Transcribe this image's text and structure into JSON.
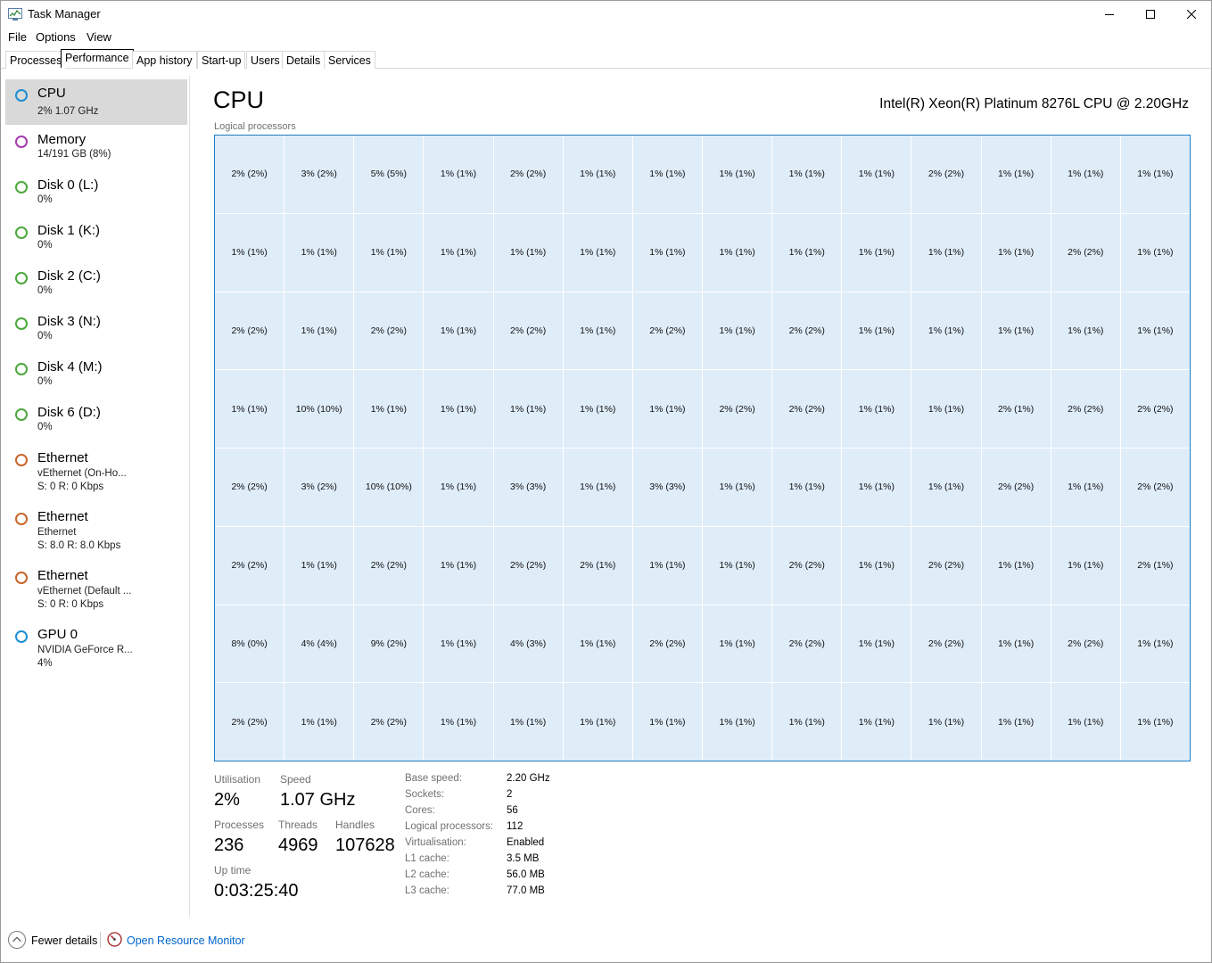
{
  "window": {
    "title": "Task Manager"
  },
  "menu": {
    "file": "File",
    "options": "Options",
    "view": "View"
  },
  "tabs": [
    "Processes",
    "Performance",
    "App history",
    "Start-up",
    "Users",
    "Details",
    "Services"
  ],
  "active_tab": "Performance",
  "sidebar": {
    "items": [
      {
        "title": "CPU",
        "lines": [
          "2%  1.07 GHz"
        ],
        "color": "#1c8fd2",
        "selected": true
      },
      {
        "title": "Memory",
        "lines": [
          "14/191 GB (8%)"
        ],
        "color": "#a63aad"
      },
      {
        "title": "Disk 0 (L:)",
        "lines": [
          "0%"
        ],
        "color": "#4ba83b"
      },
      {
        "title": "Disk 1 (K:)",
        "lines": [
          "0%"
        ],
        "color": "#4ba83b"
      },
      {
        "title": "Disk 2 (C:)",
        "lines": [
          "0%"
        ],
        "color": "#4ba83b"
      },
      {
        "title": "Disk 3 (N:)",
        "lines": [
          "0%"
        ],
        "color": "#4ba83b"
      },
      {
        "title": "Disk 4 (M:)",
        "lines": [
          "0%"
        ],
        "color": "#4ba83b"
      },
      {
        "title": "Disk 6 (D:)",
        "lines": [
          "0%"
        ],
        "color": "#4ba83b"
      },
      {
        "title": "Ethernet",
        "lines": [
          "vEthernet (On-Ho...",
          "S: 0  R: 0 Kbps"
        ],
        "color": "#c9652a"
      },
      {
        "title": "Ethernet",
        "lines": [
          "Ethernet",
          "S: 8.0  R: 8.0 Kbps"
        ],
        "color": "#c9652a"
      },
      {
        "title": "Ethernet",
        "lines": [
          "vEthernet (Default ...",
          "S: 0  R: 0 Kbps"
        ],
        "color": "#c9652a"
      },
      {
        "title": "GPU 0",
        "lines": [
          "NVIDIA GeForce R...",
          "4%"
        ],
        "color": "#1c8fd2"
      }
    ]
  },
  "main": {
    "title": "CPU",
    "cpu_name": "Intel(R) Xeon(R) Platinum 8276L CPU @ 2.20GHz",
    "grid_label": "Logical processors",
    "logical_processors": [
      [
        "2% (2%)",
        "3% (2%)",
        "5% (5%)",
        "1% (1%)",
        "2% (2%)",
        "1% (1%)",
        "1% (1%)",
        "1% (1%)",
        "1% (1%)",
        "1% (1%)",
        "2% (2%)",
        "1% (1%)",
        "1% (1%)",
        "1% (1%)"
      ],
      [
        "1% (1%)",
        "1% (1%)",
        "1% (1%)",
        "1% (1%)",
        "1% (1%)",
        "1% (1%)",
        "1% (1%)",
        "1% (1%)",
        "1% (1%)",
        "1% (1%)",
        "1% (1%)",
        "1% (1%)",
        "2% (2%)",
        "1% (1%)"
      ],
      [
        "2% (2%)",
        "1% (1%)",
        "2% (2%)",
        "1% (1%)",
        "2% (2%)",
        "1% (1%)",
        "2% (2%)",
        "1% (1%)",
        "2% (2%)",
        "1% (1%)",
        "1% (1%)",
        "1% (1%)",
        "1% (1%)",
        "1% (1%)"
      ],
      [
        "1% (1%)",
        "10% (10%)",
        "1% (1%)",
        "1% (1%)",
        "1% (1%)",
        "1% (1%)",
        "1% (1%)",
        "2% (2%)",
        "2% (2%)",
        "1% (1%)",
        "1% (1%)",
        "2% (1%)",
        "2% (2%)",
        "2% (2%)"
      ],
      [
        "2% (2%)",
        "3% (2%)",
        "10% (10%)",
        "1% (1%)",
        "3% (3%)",
        "1% (1%)",
        "3% (3%)",
        "1% (1%)",
        "1% (1%)",
        "1% (1%)",
        "1% (1%)",
        "2% (2%)",
        "1% (1%)",
        "2% (2%)"
      ],
      [
        "2% (2%)",
        "1% (1%)",
        "2% (2%)",
        "1% (1%)",
        "2% (2%)",
        "2% (1%)",
        "1% (1%)",
        "1% (1%)",
        "2% (2%)",
        "1% (1%)",
        "2% (2%)",
        "1% (1%)",
        "1% (1%)",
        "2% (1%)"
      ],
      [
        "8% (0%)",
        "4% (4%)",
        "9% (2%)",
        "1% (1%)",
        "4% (3%)",
        "1% (1%)",
        "2% (2%)",
        "1% (1%)",
        "2% (2%)",
        "1% (1%)",
        "2% (2%)",
        "1% (1%)",
        "2% (2%)",
        "1% (1%)"
      ],
      [
        "2% (2%)",
        "1% (1%)",
        "2% (2%)",
        "1% (1%)",
        "1% (1%)",
        "1% (1%)",
        "1% (1%)",
        "1% (1%)",
        "1% (1%)",
        "1% (1%)",
        "1% (1%)",
        "1% (1%)",
        "1% (1%)",
        "1% (1%)"
      ]
    ],
    "stats": {
      "utilisation_label": "Utilisation",
      "utilisation": "2%",
      "speed_label": "Speed",
      "speed": "1.07 GHz",
      "processes_label": "Processes",
      "processes": "236",
      "threads_label": "Threads",
      "threads": "4969",
      "handles_label": "Handles",
      "handles": "107628",
      "uptime_label": "Up time",
      "uptime": "0:03:25:40"
    },
    "specs": [
      {
        "label": "Base speed:",
        "value": "2.20 GHz"
      },
      {
        "label": "Sockets:",
        "value": "2"
      },
      {
        "label": "Cores:",
        "value": "56"
      },
      {
        "label": "Logical processors:",
        "value": "112"
      },
      {
        "label": "Virtualisation:",
        "value": "Enabled"
      },
      {
        "label": "L1 cache:",
        "value": "3.5 MB"
      },
      {
        "label": "L2 cache:",
        "value": "56.0 MB"
      },
      {
        "label": "L3 cache:",
        "value": "77.0 MB"
      }
    ]
  },
  "footer": {
    "fewer_details": "Fewer details",
    "open_resource_monitor": "Open Resource Monitor"
  },
  "colors": {
    "accent": "#1d7cc1",
    "grid_fill": "#dfedf9",
    "link": "#0066cc",
    "selected": "#d9d9d9"
  },
  "icons": {
    "app": "task-manager-icon",
    "minimize": "minimize-icon",
    "maximize": "maximize-icon",
    "close": "close-icon",
    "fewer": "chevron-up-circle-icon",
    "resource_monitor": "resource-monitor-icon"
  }
}
